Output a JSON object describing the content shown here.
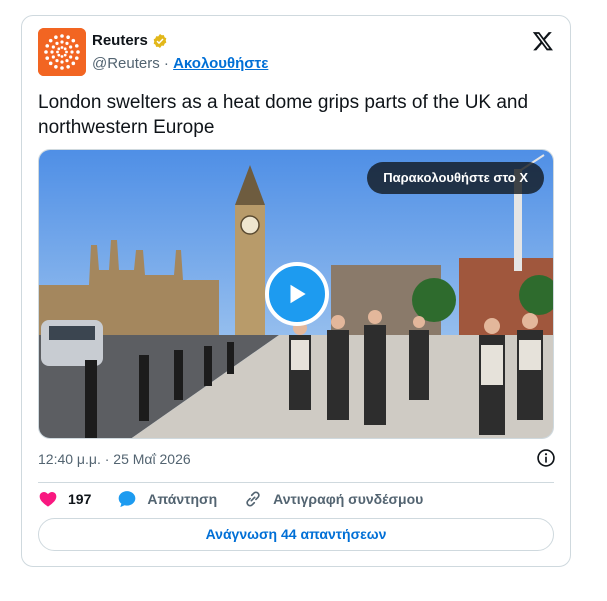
{
  "author": {
    "name": "Reuters",
    "handle": "@Reuters",
    "separator": "·",
    "follow_label": "Ακολουθήστε"
  },
  "tweet": {
    "text": "London swelters as a heat dome grips parts of the UK and northwestern Europe",
    "timestamp": "12:40 μ.μ. · 25 Μαΐ 2026"
  },
  "media": {
    "watch_label": "Παρακολουθήστε στο X"
  },
  "actions": {
    "like_count": "197",
    "reply_label": "Απάντηση",
    "copy_link_label": "Αντιγραφή συνδέσμου"
  },
  "read_replies_label": "Ανάγνωση 44 απαντήσεων",
  "colors": {
    "accent": "#1d9bf0",
    "link": "#006fd6",
    "like": "#f91880",
    "brand": "#f26522"
  },
  "icons": [
    "reuters-logo-icon",
    "verified-badge-icon",
    "x-logo-icon",
    "play-icon",
    "info-icon",
    "heart-icon",
    "reply-bubble-icon",
    "link-icon"
  ]
}
